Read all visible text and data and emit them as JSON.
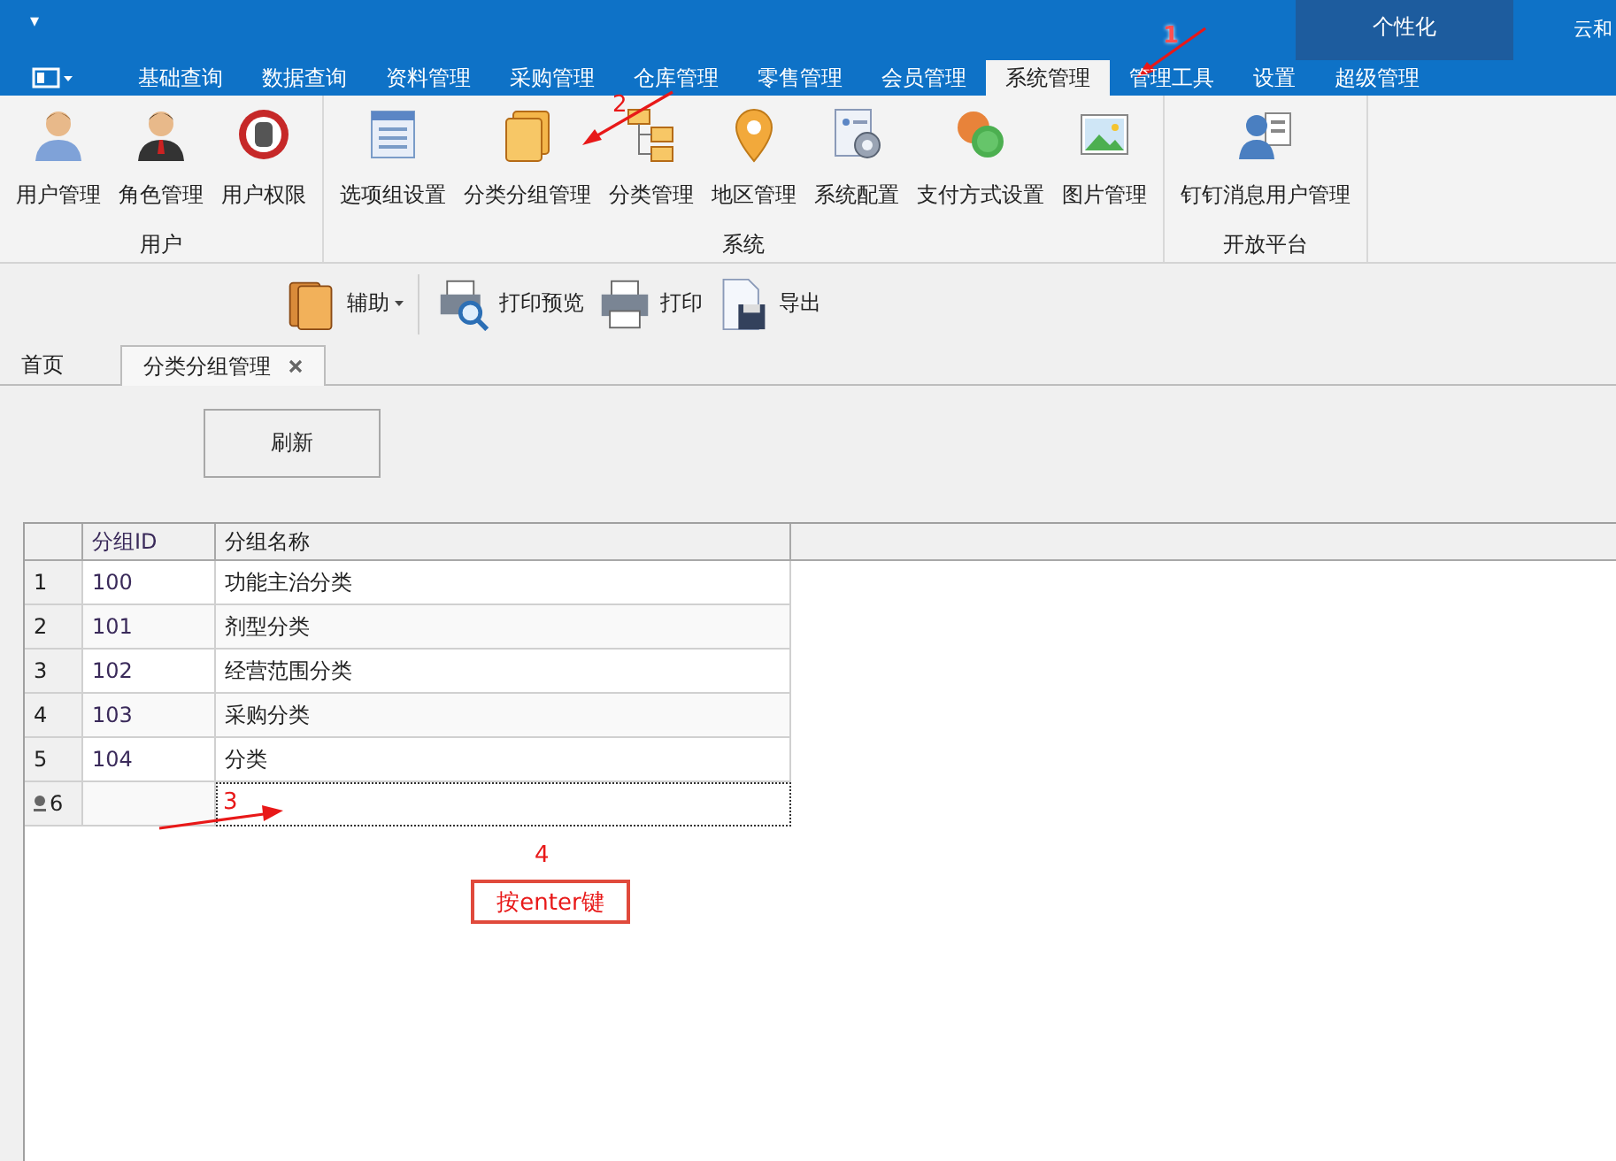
{
  "quick_access": "▾",
  "personalize": "个性化",
  "cut_label": "云和",
  "menu_tabs": [
    {
      "label": "基础查询",
      "selected": false
    },
    {
      "label": "数据查询",
      "selected": false
    },
    {
      "label": "资料管理",
      "selected": false
    },
    {
      "label": "采购管理",
      "selected": false
    },
    {
      "label": "仓库管理",
      "selected": false
    },
    {
      "label": "零售管理",
      "selected": false
    },
    {
      "label": "会员管理",
      "selected": false
    },
    {
      "label": "系统管理",
      "selected": true
    },
    {
      "label": "管理工具",
      "selected": false
    },
    {
      "label": "设置",
      "selected": false
    },
    {
      "label": "超级管理",
      "selected": false
    }
  ],
  "ribbon_groups": [
    {
      "label": "用户",
      "buttons": [
        "用户管理",
        "角色管理",
        "用户权限"
      ]
    },
    {
      "label": "系统",
      "buttons": [
        "选项组设置",
        "分类分组管理",
        "分类管理",
        "地区管理",
        "系统配置",
        "支付方式设置",
        "图片管理"
      ]
    },
    {
      "label": "开放平台",
      "buttons": [
        "钉钉消息用户管理"
      ]
    }
  ],
  "toolbar": [
    {
      "label": "辅助",
      "dropdown": true
    },
    {
      "label": "打印预览",
      "dropdown": false
    },
    {
      "label": "打印",
      "dropdown": false
    },
    {
      "label": "导出",
      "dropdown": false
    }
  ],
  "doc_tabs": [
    {
      "label": "首页",
      "selected": false,
      "closable": false
    },
    {
      "label": "分类分组管理",
      "selected": true,
      "closable": true
    }
  ],
  "refresh_button": "刷新",
  "grid": {
    "columns": [
      "分组ID",
      "分组名称"
    ],
    "rows": [
      {
        "number": "1",
        "id": "100",
        "name": "功能主治分类",
        "editing": false
      },
      {
        "number": "2",
        "id": "101",
        "name": "剂型分类",
        "editing": false
      },
      {
        "number": "3",
        "id": "102",
        "name": "经营范围分类",
        "editing": false
      },
      {
        "number": "4",
        "id": "103",
        "name": "采购分类",
        "editing": false
      },
      {
        "number": "5",
        "id": "104",
        "name": "分类",
        "editing": false
      },
      {
        "number": "6",
        "editing": true
      }
    ]
  },
  "annotations": [
    {
      "number": "1"
    },
    {
      "number": "2"
    },
    {
      "number": "3"
    },
    {
      "number": "4",
      "note": "按enter键"
    }
  ]
}
